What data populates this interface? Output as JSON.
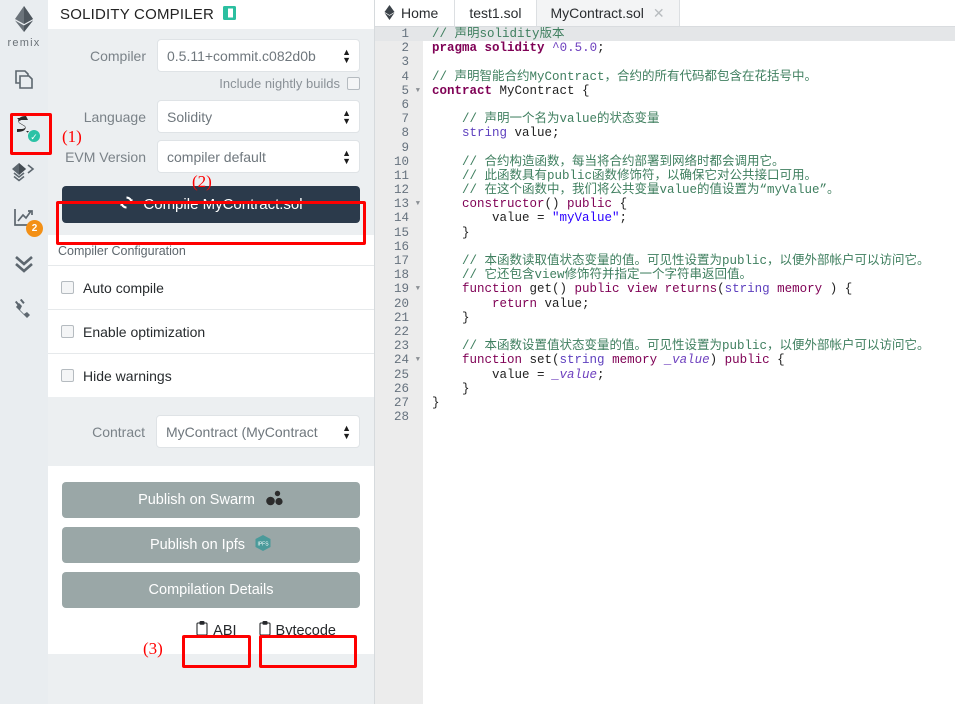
{
  "rail": {
    "brand": "remix",
    "items": [
      {
        "name": "file-explorers",
        "icon": "files-icon",
        "badge": null
      },
      {
        "name": "solidity-compiler",
        "icon": "compiler-icon",
        "badge": "check"
      },
      {
        "name": "deploy-run-transactions",
        "icon": "deploy-icon",
        "badge": null
      },
      {
        "name": "analysis",
        "icon": "analysis-icon",
        "badge": "2"
      },
      {
        "name": "debugger",
        "icon": "debugger-icon",
        "badge": null
      },
      {
        "name": "plugin-manager",
        "icon": "plug-icon",
        "badge": null
      }
    ]
  },
  "panel": {
    "title": "SOLIDITY COMPILER",
    "title_icon": "book-icon",
    "compiler_label": "Compiler",
    "compiler_value": "0.5.11+commit.c082d0b",
    "nightly_label": "Include nightly builds",
    "language_label": "Language",
    "language_value": "Solidity",
    "evm_label": "EVM Version",
    "evm_value": "compiler default",
    "compile_button": "Compile MyContract.sol",
    "config_heading": "Compiler Configuration",
    "options": [
      {
        "label": "Auto compile",
        "checked": false
      },
      {
        "label": "Enable optimization",
        "checked": false
      },
      {
        "label": "Hide warnings",
        "checked": false
      }
    ],
    "contract_label": "Contract",
    "contract_value": "MyContract (MyContract",
    "publish_swarm": "Publish on Swarm",
    "publish_ipfs": "Publish on Ipfs",
    "compilation_details": "Compilation Details",
    "abi_button": "ABI",
    "bytecode_button": "Bytecode"
  },
  "tabs": [
    {
      "label": "Home",
      "icon": "remix-mini-logo",
      "active": false,
      "closable": false
    },
    {
      "label": "test1.sol",
      "icon": null,
      "active": false,
      "closable": false
    },
    {
      "label": "MyContract.sol",
      "icon": null,
      "active": true,
      "closable": true
    }
  ],
  "editor": {
    "close_glyph": "✕",
    "lines": [
      {
        "n": 1,
        "fold": false,
        "active": true,
        "tokens": [
          {
            "t": "// 声明solidity版本",
            "c": "c-com"
          }
        ]
      },
      {
        "n": 2,
        "fold": false,
        "tokens": [
          {
            "t": "pragma",
            "c": "c-kw"
          },
          {
            "t": " ",
            "c": "c-pun"
          },
          {
            "t": "solidity",
            "c": "c-kw"
          },
          {
            "t": " ",
            "c": "c-pun"
          },
          {
            "t": "^0.5.0",
            "c": "c-num"
          },
          {
            "t": ";",
            "c": "c-pun"
          }
        ]
      },
      {
        "n": 3,
        "fold": false,
        "tokens": []
      },
      {
        "n": 4,
        "fold": false,
        "tokens": [
          {
            "t": "// 声明智能合约MyContract，合约的所有代码都包含在花括号中。",
            "c": "c-com"
          }
        ]
      },
      {
        "n": 5,
        "fold": true,
        "tokens": [
          {
            "t": "contract",
            "c": "c-kw"
          },
          {
            "t": " ",
            "c": "c-pun"
          },
          {
            "t": "MyContract",
            "c": "c-id"
          },
          {
            "t": " {",
            "c": "c-pun"
          }
        ]
      },
      {
        "n": 6,
        "fold": false,
        "tokens": []
      },
      {
        "n": 7,
        "fold": false,
        "tokens": [
          {
            "t": "    // 声明一个名为value的状态变量",
            "c": "c-com"
          }
        ]
      },
      {
        "n": 8,
        "fold": false,
        "tokens": [
          {
            "t": "    ",
            "c": "c-pun"
          },
          {
            "t": "string",
            "c": "c-typ"
          },
          {
            "t": " value;",
            "c": "c-pun"
          }
        ]
      },
      {
        "n": 9,
        "fold": false,
        "tokens": []
      },
      {
        "n": 10,
        "fold": false,
        "tokens": [
          {
            "t": "    // 合约构造函数，每当将合约部署到网络时都会调用它。",
            "c": "c-com"
          }
        ]
      },
      {
        "n": 11,
        "fold": false,
        "tokens": [
          {
            "t": "    // 此函数具有public函数修饰符，以确保它对公共接口可用。",
            "c": "c-com"
          }
        ]
      },
      {
        "n": 12,
        "fold": false,
        "tokens": [
          {
            "t": "    // 在这个函数中，我们将公共变量value的值设置为“myValue”。",
            "c": "c-com"
          }
        ]
      },
      {
        "n": 13,
        "fold": true,
        "tokens": [
          {
            "t": "    ",
            "c": "c-pun"
          },
          {
            "t": "constructor",
            "c": "c-kw2"
          },
          {
            "t": "() ",
            "c": "c-pun"
          },
          {
            "t": "public",
            "c": "c-kw2"
          },
          {
            "t": " {",
            "c": "c-pun"
          }
        ]
      },
      {
        "n": 14,
        "fold": false,
        "tokens": [
          {
            "t": "        value = ",
            "c": "c-pun"
          },
          {
            "t": "\"myValue\"",
            "c": "c-str"
          },
          {
            "t": ";",
            "c": "c-pun"
          }
        ]
      },
      {
        "n": 15,
        "fold": false,
        "tokens": [
          {
            "t": "    }",
            "c": "c-pun"
          }
        ]
      },
      {
        "n": 16,
        "fold": false,
        "tokens": []
      },
      {
        "n": 17,
        "fold": false,
        "tokens": [
          {
            "t": "    // 本函数读取值状态变量的值。可见性设置为public，以便外部帐户可以访问它。",
            "c": "c-com"
          }
        ]
      },
      {
        "n": 18,
        "fold": false,
        "tokens": [
          {
            "t": "    // 它还包含view修饰符并指定一个字符串返回值。",
            "c": "c-com"
          }
        ]
      },
      {
        "n": 19,
        "fold": true,
        "tokens": [
          {
            "t": "    ",
            "c": "c-pun"
          },
          {
            "t": "function",
            "c": "c-kw2"
          },
          {
            "t": " get() ",
            "c": "c-pun"
          },
          {
            "t": "public",
            "c": "c-kw2"
          },
          {
            "t": " ",
            "c": "c-pun"
          },
          {
            "t": "view",
            "c": "c-kw2"
          },
          {
            "t": " ",
            "c": "c-pun"
          },
          {
            "t": "returns",
            "c": "c-kw2"
          },
          {
            "t": "(",
            "c": "c-pun"
          },
          {
            "t": "string",
            "c": "c-typ"
          },
          {
            "t": " ",
            "c": "c-pun"
          },
          {
            "t": "memory",
            "c": "c-kw2"
          },
          {
            "t": " ) {",
            "c": "c-pun"
          }
        ]
      },
      {
        "n": 20,
        "fold": false,
        "tokens": [
          {
            "t": "        ",
            "c": "c-pun"
          },
          {
            "t": "return",
            "c": "c-kw2"
          },
          {
            "t": " value;",
            "c": "c-pun"
          }
        ]
      },
      {
        "n": 21,
        "fold": false,
        "tokens": [
          {
            "t": "    }",
            "c": "c-pun"
          }
        ]
      },
      {
        "n": 22,
        "fold": false,
        "tokens": []
      },
      {
        "n": 23,
        "fold": false,
        "tokens": [
          {
            "t": "    // 本函数设置值状态变量的值。可见性设置为public，以便外部帐户可以访问它。",
            "c": "c-com"
          }
        ]
      },
      {
        "n": 24,
        "fold": true,
        "tokens": [
          {
            "t": "    ",
            "c": "c-pun"
          },
          {
            "t": "function",
            "c": "c-kw2"
          },
          {
            "t": " set(",
            "c": "c-pun"
          },
          {
            "t": "string",
            "c": "c-typ"
          },
          {
            "t": " ",
            "c": "c-pun"
          },
          {
            "t": "memory",
            "c": "c-kw2"
          },
          {
            "t": " ",
            "c": "c-pun"
          },
          {
            "t": "_value",
            "c": "c-ital"
          },
          {
            "t": ") ",
            "c": "c-pun"
          },
          {
            "t": "public",
            "c": "c-kw2"
          },
          {
            "t": " {",
            "c": "c-pun"
          }
        ]
      },
      {
        "n": 25,
        "fold": false,
        "tokens": [
          {
            "t": "        value = ",
            "c": "c-pun"
          },
          {
            "t": "_value",
            "c": "c-ital"
          },
          {
            "t": ";",
            "c": "c-pun"
          }
        ]
      },
      {
        "n": 26,
        "fold": false,
        "tokens": [
          {
            "t": "    }",
            "c": "c-pun"
          }
        ]
      },
      {
        "n": 27,
        "fold": false,
        "tokens": [
          {
            "t": "}",
            "c": "c-pun"
          }
        ]
      },
      {
        "n": 28,
        "fold": false,
        "tokens": []
      }
    ]
  },
  "annotations": {
    "color": "#fe0000",
    "labels": [
      {
        "id": "1",
        "text": "(1)"
      },
      {
        "id": "2",
        "text": "(2)"
      },
      {
        "id": "3",
        "text": "(3)"
      }
    ]
  },
  "colors": {
    "accent_dark": "#2b3a4b",
    "panel_bg": "#eceff1",
    "rail_bg": "#e9edf0",
    "publish_btn": "#9aa7a7",
    "badge_orange": "#f39016",
    "check_teal": "#2bc2a6",
    "annotation_red": "#fe0000"
  }
}
